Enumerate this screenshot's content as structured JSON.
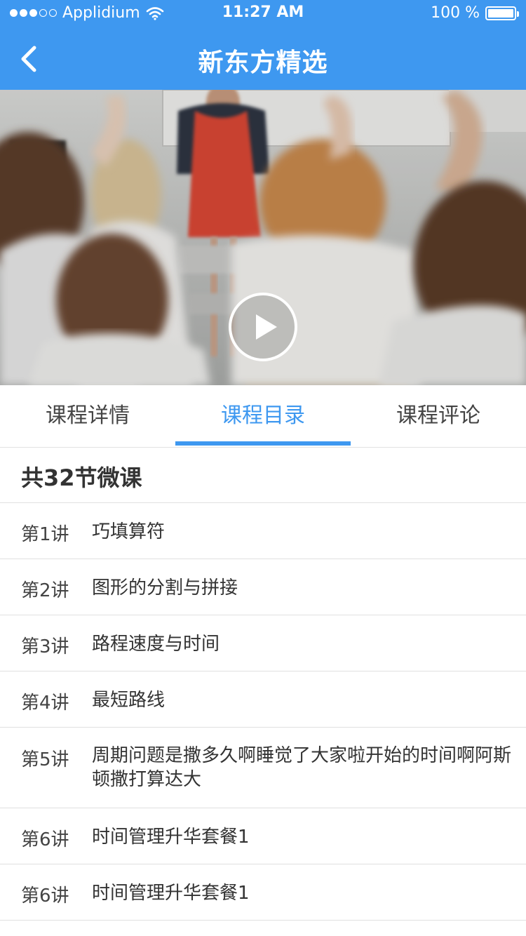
{
  "status_bar": {
    "carrier": "Applidium",
    "time": "11:27 AM",
    "battery": "100 %"
  },
  "nav": {
    "title": "新东方精选",
    "back_icon": "chevron-left-icon"
  },
  "video": {
    "play_icon": "play-circle-icon"
  },
  "tabs": [
    {
      "label": "课程详情",
      "active": false
    },
    {
      "label": "课程目录",
      "active": true
    },
    {
      "label": "课程评论",
      "active": false
    }
  ],
  "catalog": {
    "count_label": "共32节微课",
    "lessons": [
      {
        "num": "第1讲",
        "title": "巧填算符"
      },
      {
        "num": "第2讲",
        "title": "图形的分割与拼接"
      },
      {
        "num": "第3讲",
        "title": "路程速度与时间"
      },
      {
        "num": "第4讲",
        "title": "最短路线"
      },
      {
        "num": "第5讲",
        "title": "周期问题是撒多久啊睡觉了大家啦开始的时间啊阿斯顿撒打算达大"
      },
      {
        "num": "第6讲",
        "title": "时间管理升华套餐1"
      },
      {
        "num": "第6讲",
        "title": "时间管理升华套餐1"
      }
    ]
  },
  "colors": {
    "primary": "#3e98f0",
    "text": "#333333",
    "divider": "#e0e0e0"
  }
}
